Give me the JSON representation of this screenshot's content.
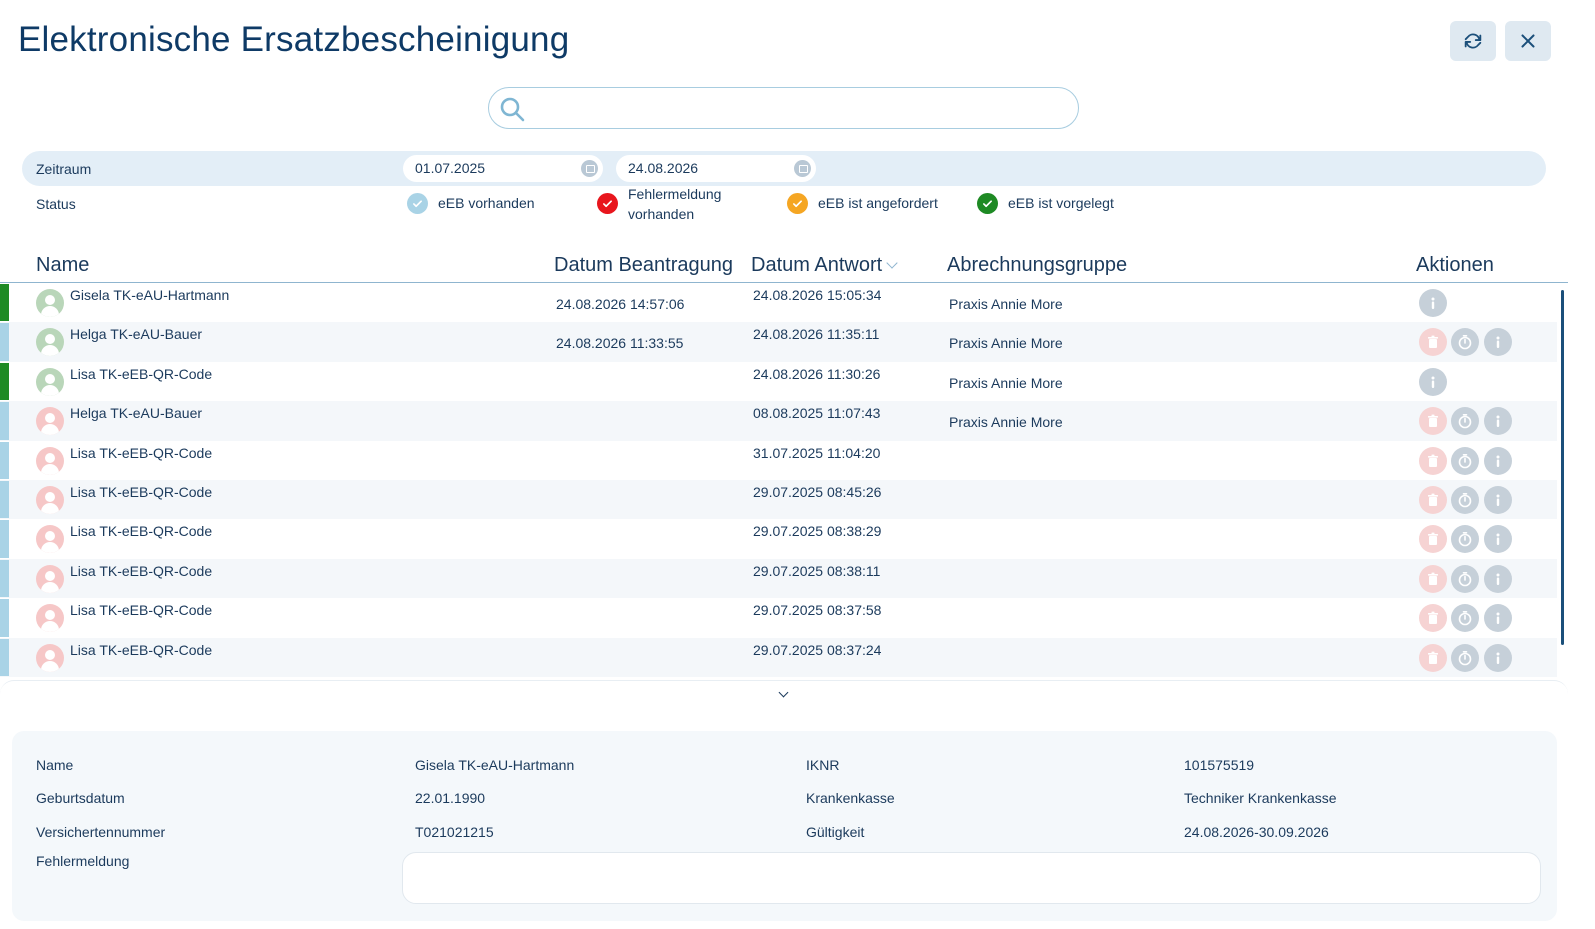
{
  "window": {
    "title": "Elektronische Ersatzbescheinigung",
    "refresh_icon": "refresh-icon",
    "close_icon": "close-icon"
  },
  "search": {
    "value": "",
    "placeholder": "",
    "icon": "search-icon"
  },
  "filters": {
    "zeitraum_label": "Zeitraum",
    "date_from": "01.07.2025",
    "date_to": "24.08.2026",
    "status_label": "Status",
    "statuses": [
      {
        "label": "eEB vorhanden",
        "color": "#a9d3e6"
      },
      {
        "label_line1": "Fehlermeldung",
        "label_line2": "vorhanden",
        "color": "#e8161d"
      },
      {
        "label": "eEB ist angefordert",
        "color": "#f5a623"
      },
      {
        "label": "eEB ist vorgelegt",
        "color": "#1e8a24"
      }
    ]
  },
  "table": {
    "columns": {
      "name": "Name",
      "datum_beantragung": "Datum Beantragung",
      "datum_antwort": "Datum Antwort",
      "abrechnungsgruppe": "Abrechnungsgruppe",
      "aktionen": "Aktionen"
    },
    "rows": [
      {
        "name": "Gisela TK-eAU-Hartmann",
        "beantragung": "24.08.2026 14:57:06",
        "antwort": "24.08.2026 15:05:34",
        "gruppe": "Praxis Annie More",
        "status": "vorgelegt",
        "avatar": "green"
      },
      {
        "name": "Helga TK-eAU-Bauer",
        "beantragung": "24.08.2026 11:33:55",
        "antwort": "24.08.2026 11:35:11",
        "gruppe": "Praxis Annie More",
        "status": "vorhanden",
        "avatar": "green"
      },
      {
        "name": "Lisa TK-eEB-QR-Code",
        "beantragung": "",
        "antwort": "24.08.2026 11:30:26",
        "gruppe": "Praxis Annie More",
        "status": "vorgelegt",
        "avatar": "green"
      },
      {
        "name": "Helga TK-eAU-Bauer",
        "beantragung": "",
        "antwort": "08.08.2025 11:07:43",
        "gruppe": "Praxis Annie More",
        "status": "vorhanden",
        "avatar": "red"
      },
      {
        "name": "Lisa TK-eEB-QR-Code",
        "beantragung": "",
        "antwort": "31.07.2025 11:04:20",
        "gruppe": "",
        "status": "vorhanden",
        "avatar": "red"
      },
      {
        "name": "Lisa TK-eEB-QR-Code",
        "beantragung": "",
        "antwort": "29.07.2025 08:45:26",
        "gruppe": "",
        "status": "vorhanden",
        "avatar": "red"
      },
      {
        "name": "Lisa TK-eEB-QR-Code",
        "beantragung": "",
        "antwort": "29.07.2025 08:38:29",
        "gruppe": "",
        "status": "vorhanden",
        "avatar": "red"
      },
      {
        "name": "Lisa TK-eEB-QR-Code",
        "beantragung": "",
        "antwort": "29.07.2025 08:38:11",
        "gruppe": "",
        "status": "vorhanden",
        "avatar": "red"
      },
      {
        "name": "Lisa TK-eEB-QR-Code",
        "beantragung": "",
        "antwort": "29.07.2025 08:37:58",
        "gruppe": "",
        "status": "vorhanden",
        "avatar": "red"
      },
      {
        "name": "Lisa TK-eEB-QR-Code",
        "beantragung": "",
        "antwort": "29.07.2025 08:37:24",
        "gruppe": "",
        "status": "vorhanden",
        "avatar": "red"
      }
    ]
  },
  "details": {
    "name_label": "Name",
    "name_value": "Gisela TK-eAU-Hartmann",
    "geburtsdatum_label": "Geburtsdatum",
    "geburtsdatum_value": "22.01.1990",
    "versichertennummer_label": "Versichertennummer",
    "versichertennummer_value": "T021021215",
    "fehlermeldung_label": "Fehlermeldung",
    "fehlermeldung_value": "",
    "iknr_label": "IKNR",
    "iknr_value": "101575519",
    "krankenkasse_label": "Krankenkasse",
    "krankenkasse_value": "Techniker Krankenkasse",
    "gueltigkeit_label": "Gültigkeit",
    "gueltigkeit_value": "24.08.2026-30.09.2026"
  },
  "colors": {
    "title": "#0e3a66",
    "accent_light": "#e3eef7",
    "status_green": "#1e8a24",
    "status_blue": "#a9d3e6",
    "avatar_green": "#b9d6b9",
    "avatar_red": "#f6c7c7"
  }
}
